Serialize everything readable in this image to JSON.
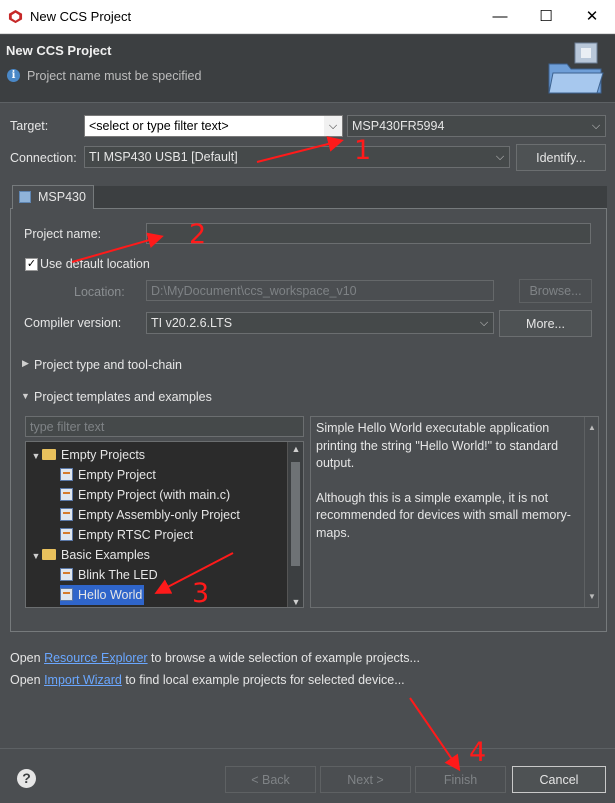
{
  "window": {
    "title": "New CCS Project",
    "minimize": "—",
    "maximize": "☐",
    "close": "✕"
  },
  "header": {
    "title": "New CCS Project",
    "message": "Project name must be specified"
  },
  "target": {
    "label": "Target:",
    "filter_placeholder": "<select or type filter text>",
    "device_value": "MSP430FR5994"
  },
  "connection": {
    "label": "Connection:",
    "value": "TI MSP430 USB1 [Default]",
    "identify_label": "Identify..."
  },
  "tab": {
    "label": "MSP430"
  },
  "project_name": {
    "label": "Project name:",
    "value": ""
  },
  "default_location": {
    "label": "Use default location",
    "checked": true
  },
  "location": {
    "label": "Location:",
    "value": "D:\\MyDocument\\ccs_workspace_v10",
    "browse_label": "Browse..."
  },
  "compiler": {
    "label": "Compiler version:",
    "value": "TI v20.2.6.LTS",
    "more_label": "More..."
  },
  "sections": {
    "toolchain": "Project type and tool-chain",
    "templates": "Project templates and examples"
  },
  "templates_filter_placeholder": "type filter text",
  "tree": {
    "items": [
      {
        "label": "Empty Projects",
        "kind": "folder",
        "level": 0
      },
      {
        "label": "Empty Project",
        "kind": "project",
        "level": 1
      },
      {
        "label": "Empty Project (with main.c)",
        "kind": "project",
        "level": 1
      },
      {
        "label": "Empty Assembly-only Project",
        "kind": "project",
        "level": 1
      },
      {
        "label": "Empty RTSC Project",
        "kind": "project",
        "level": 1
      },
      {
        "label": "Basic Examples",
        "kind": "folder",
        "level": 0
      },
      {
        "label": "Blink The LED",
        "kind": "project",
        "level": 1
      },
      {
        "label": "Hello World",
        "kind": "project",
        "level": 1,
        "selected": true
      }
    ]
  },
  "description": {
    "para1": "Simple Hello World executable application printing the string \"Hello World!\" to standard output.",
    "para2": "Although this is a simple example, it is not recommended for devices with small memory-maps."
  },
  "footer_links": {
    "line1_pre": "Open ",
    "line1_link": "Resource Explorer",
    "line1_post": " to browse a wide selection of example projects...",
    "line2_pre": "Open ",
    "line2_link": "Import Wizard",
    "line2_post": " to find local example projects for selected device..."
  },
  "buttons": {
    "back": "< Back",
    "next": "Next >",
    "finish": "Finish",
    "cancel": "Cancel",
    "help": "?"
  },
  "annotations": [
    "1",
    "2",
    "3",
    "4"
  ],
  "colors": {
    "dialog_bg": "#4b4e51",
    "header_bg": "#3c3f41",
    "selection": "#2f65ca",
    "annotation": "#ff1a1a",
    "link": "#6aa7ff"
  }
}
